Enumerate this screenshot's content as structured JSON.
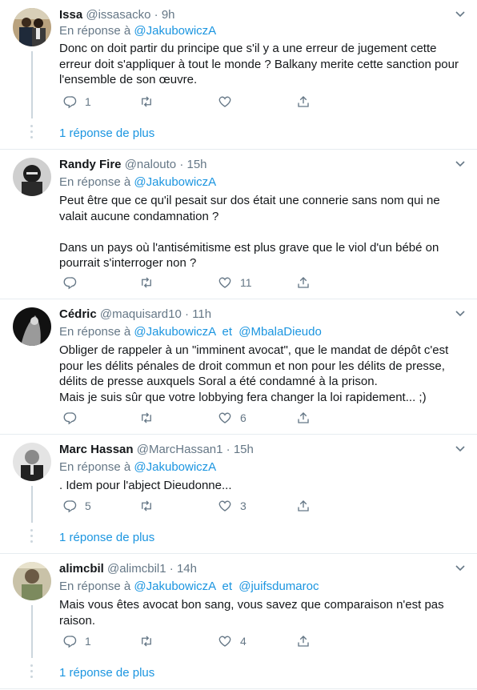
{
  "tweets": [
    {
      "name": "Issa",
      "handle": "@issasacko",
      "time": "9h",
      "reply_prefix": "En réponse à",
      "reply_to": [
        "@JakubowiczA"
      ],
      "text": "Donc on doit partir du principe que s'il y a une erreur de jugement cette\nerreur doit s'appliquer à tout le monde ? Balkany merite cette sanction pour\nl'ensemble de son œuvre.",
      "replies": "1",
      "retweets": "",
      "likes": ""
    },
    {
      "name": "Randy Fire",
      "handle": "@nalouto",
      "time": "15h",
      "reply_prefix": "En réponse à",
      "reply_to": [
        "@JakubowiczA"
      ],
      "text": "Peut être que ce qu'il pesait sur dos était une connerie sans nom qui ne\nvalait aucune condamnation ?\n\nDans un pays où l'antisémitisme est plus grave que le viol d'un bébé on\npourrait s'interroger non ?",
      "replies": "",
      "retweets": "",
      "likes": "11"
    },
    {
      "name": "Cédric",
      "handle": "@maquisard10",
      "time": "11h",
      "reply_prefix": "En réponse à",
      "reply_to": [
        "@JakubowiczA",
        "@MbalaDieudo"
      ],
      "reply_joiner": "et",
      "text": "Obliger de rappeler à un \"imminent avocat\", que le mandat de dépôt c'est\npour les délits pénales de droit commun et non pour les délits de presse,\ndélits de presse auxquels Soral a été condamné à la prison.\nMais je suis sûr que votre lobbying fera changer la loi rapidement... ;)",
      "replies": "",
      "retweets": "",
      "likes": "6"
    },
    {
      "name": "Marc Hassan",
      "handle": "@MarcHassan1",
      "time": "15h",
      "reply_prefix": "En réponse à",
      "reply_to": [
        "@JakubowiczA"
      ],
      "text": ". Idem pour l'abject Dieudonne...",
      "replies": "5",
      "retweets": "",
      "likes": "3"
    },
    {
      "name": "alimcbil",
      "handle": "@alimcbil1",
      "time": "14h",
      "reply_prefix": "En réponse à",
      "reply_to": [
        "@JakubowiczA",
        "@juifsdumaroc"
      ],
      "reply_joiner": "et",
      "text": "Mais vous êtes avocat bon sang, vous savez que comparaison n'est pas\nraison.",
      "replies": "1",
      "retweets": "",
      "likes": "4"
    }
  ],
  "more_replies_label": "1 réponse de plus",
  "separator": "·",
  "icons": [
    "reply-icon",
    "retweet-icon",
    "like-icon",
    "share-icon",
    "chevron-down-icon"
  ],
  "colors": {
    "link": "#1b95e0",
    "muted": "#657786",
    "text": "#14171a",
    "divider": "#e6ecf0"
  }
}
